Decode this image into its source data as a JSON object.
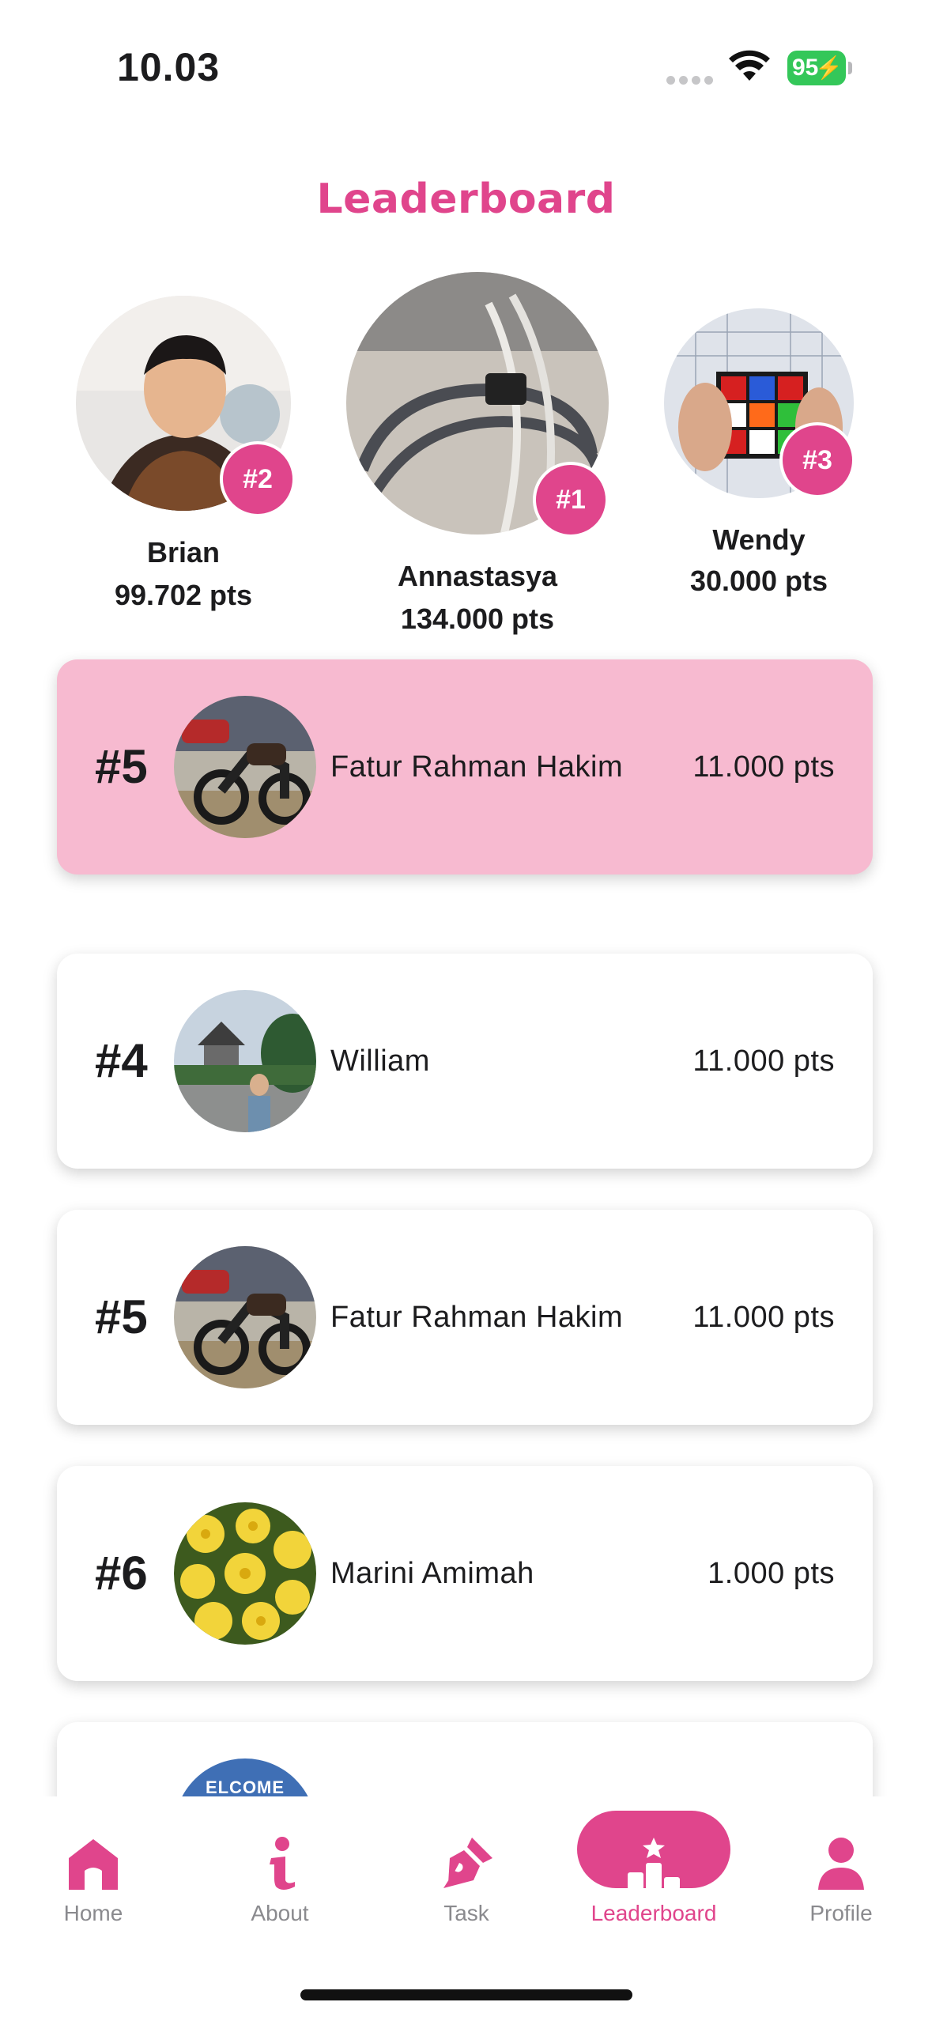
{
  "status_bar": {
    "time": "10.03",
    "battery": "95"
  },
  "title": "Leaderboard",
  "podium": [
    {
      "rank": "#2",
      "name": "Brian",
      "points": "99.702 pts"
    },
    {
      "rank": "#1",
      "name": "Annastasya",
      "points": "134.000 pts"
    },
    {
      "rank": "#3",
      "name": "Wendy",
      "points": "30.000 pts"
    }
  ],
  "current_user": {
    "rank": "#5",
    "name": "Fatur Rahman Hakim",
    "points": "11.000 pts"
  },
  "list": [
    {
      "rank": "#4",
      "name": "William",
      "points": "11.000 pts"
    },
    {
      "rank": "#5",
      "name": "Fatur Rahman Hakim",
      "points": "11.000 pts"
    },
    {
      "rank": "#6",
      "name": "Marini Amimah",
      "points": "1.000 pts"
    }
  ],
  "partial_avatar_text": "ELCOME",
  "nav": [
    {
      "label": "Home",
      "icon": "home-icon"
    },
    {
      "label": "About",
      "icon": "info-icon"
    },
    {
      "label": "Task",
      "icon": "pen-icon"
    },
    {
      "label": "Leaderboard",
      "icon": "podium-icon",
      "active": true
    },
    {
      "label": "Profile",
      "icon": "person-icon"
    }
  ],
  "colors": {
    "accent": "#e0458c",
    "highlight_card": "#f7bad0",
    "battery": "#34c759"
  }
}
